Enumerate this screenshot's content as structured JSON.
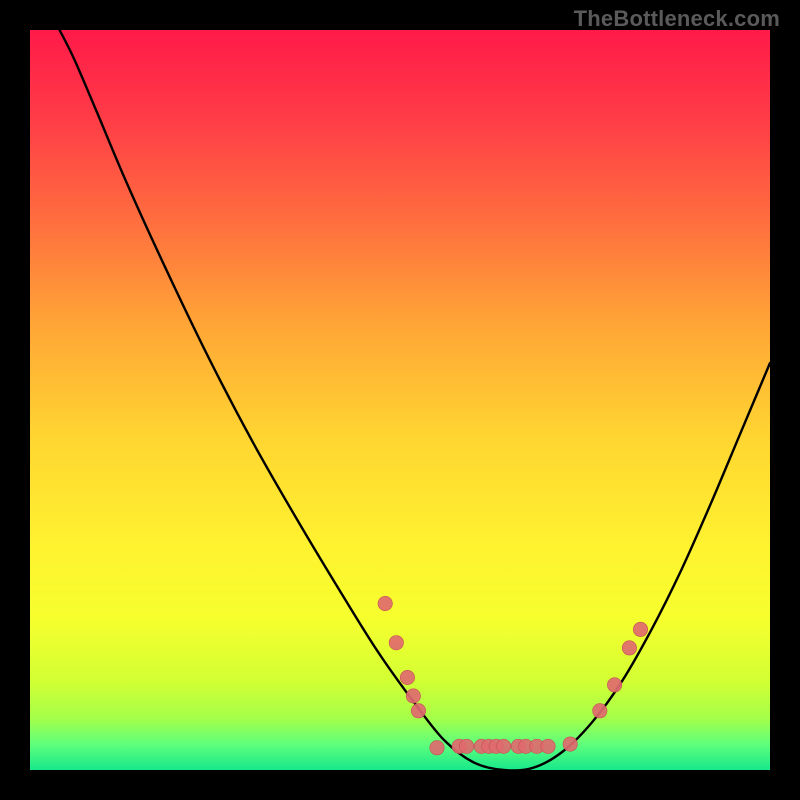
{
  "watermark": "TheBottleneck.com",
  "colors": {
    "background": "#000000",
    "gradient_stops": [
      {
        "offset": 0.0,
        "color": "#ff1a49"
      },
      {
        "offset": 0.12,
        "color": "#ff3c47"
      },
      {
        "offset": 0.25,
        "color": "#ff6b3f"
      },
      {
        "offset": 0.4,
        "color": "#ffa636"
      },
      {
        "offset": 0.55,
        "color": "#ffd531"
      },
      {
        "offset": 0.7,
        "color": "#fff32f"
      },
      {
        "offset": 0.8,
        "color": "#f5ff2e"
      },
      {
        "offset": 0.88,
        "color": "#d2ff33"
      },
      {
        "offset": 0.93,
        "color": "#a5ff4a"
      },
      {
        "offset": 0.965,
        "color": "#5fff7b"
      },
      {
        "offset": 1.0,
        "color": "#17e88b"
      }
    ],
    "curve": "#000000",
    "marker_fill": "#e06a6f",
    "marker_stroke": "#c54f55"
  },
  "chart_data": {
    "type": "line",
    "title": "",
    "xlabel": "",
    "ylabel": "",
    "xlim": [
      0,
      100
    ],
    "ylim": [
      0,
      100
    ],
    "curve": [
      {
        "x": 4.0,
        "y": 100.0
      },
      {
        "x": 6.0,
        "y": 96.0
      },
      {
        "x": 9.0,
        "y": 89.0
      },
      {
        "x": 13.0,
        "y": 79.5
      },
      {
        "x": 18.0,
        "y": 68.5
      },
      {
        "x": 24.0,
        "y": 56.0
      },
      {
        "x": 30.0,
        "y": 44.5
      },
      {
        "x": 36.0,
        "y": 34.0
      },
      {
        "x": 42.0,
        "y": 24.0
      },
      {
        "x": 47.0,
        "y": 16.0
      },
      {
        "x": 52.0,
        "y": 9.0
      },
      {
        "x": 56.0,
        "y": 4.0
      },
      {
        "x": 60.0,
        "y": 1.0
      },
      {
        "x": 64.0,
        "y": 0.0
      },
      {
        "x": 68.0,
        "y": 0.3
      },
      {
        "x": 72.0,
        "y": 2.5
      },
      {
        "x": 76.0,
        "y": 6.5
      },
      {
        "x": 80.0,
        "y": 12.0
      },
      {
        "x": 84.0,
        "y": 19.0
      },
      {
        "x": 88.0,
        "y": 27.0
      },
      {
        "x": 92.0,
        "y": 36.0
      },
      {
        "x": 96.0,
        "y": 45.5
      },
      {
        "x": 100.0,
        "y": 55.0
      }
    ],
    "markers": [
      {
        "x": 48.0,
        "y": 22.5
      },
      {
        "x": 49.5,
        "y": 17.2
      },
      {
        "x": 51.0,
        "y": 12.5
      },
      {
        "x": 51.8,
        "y": 10.0
      },
      {
        "x": 52.5,
        "y": 8.0
      },
      {
        "x": 55.0,
        "y": 3.0
      },
      {
        "x": 58.0,
        "y": 3.2
      },
      {
        "x": 59.0,
        "y": 3.2
      },
      {
        "x": 61.0,
        "y": 3.2
      },
      {
        "x": 62.0,
        "y": 3.2
      },
      {
        "x": 63.0,
        "y": 3.2
      },
      {
        "x": 64.0,
        "y": 3.2
      },
      {
        "x": 66.0,
        "y": 3.2
      },
      {
        "x": 67.0,
        "y": 3.2
      },
      {
        "x": 68.5,
        "y": 3.2
      },
      {
        "x": 70.0,
        "y": 3.2
      },
      {
        "x": 73.0,
        "y": 3.5
      },
      {
        "x": 77.0,
        "y": 8.0
      },
      {
        "x": 79.0,
        "y": 11.5
      },
      {
        "x": 81.0,
        "y": 16.5
      },
      {
        "x": 82.5,
        "y": 19.0
      }
    ]
  }
}
